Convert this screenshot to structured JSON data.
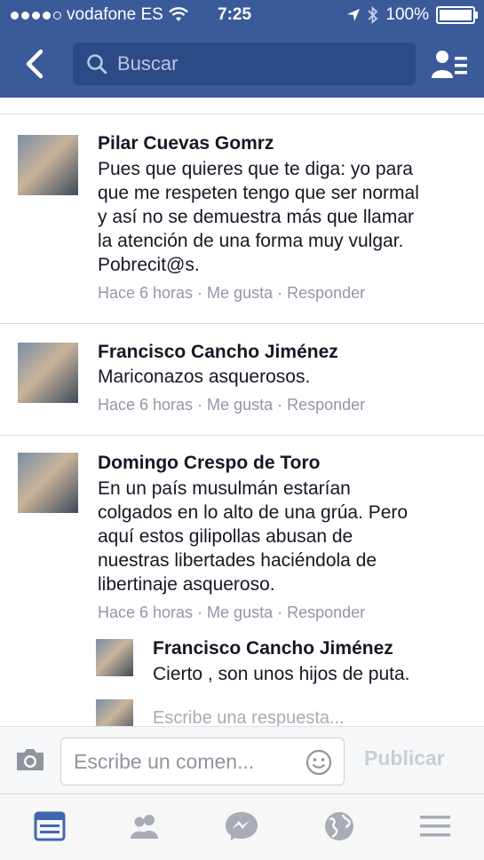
{
  "status_bar": {
    "carrier": "vodafone ES",
    "time": "7:25",
    "battery": "100%"
  },
  "search": {
    "placeholder": "Buscar"
  },
  "comments": [
    {
      "name": "Pilar Cuevas Gomrz",
      "lines": [
        "Pues que quieres que te diga: yo para",
        "que me respeten tengo que ser normal",
        "y así no se demuestra  más que llamar",
        "la atención de una forma muy vulgar.",
        "Pobrecit@s."
      ],
      "meta": "Hace 6 horas · Me gusta · Responder"
    },
    {
      "name": "Francisco Cancho Jiménez",
      "lines": [
        "Mariconazos asquerosos."
      ],
      "meta": "Hace 6 horas · Me gusta · Responder"
    },
    {
      "name": "Domingo Crespo de Toro",
      "lines": [
        "En un país musulmán  estarían",
        "colgados en lo alto de una grúa. Pero",
        "aquí estos gilipollas abusan de",
        "nuestras libertades haciéndola de",
        "libertinaje asqueroso."
      ],
      "meta": "Hace 6 horas · Me gusta · Responder"
    }
  ],
  "reply": {
    "name": "Francisco Cancho Jiménez",
    "text": "Cierto , son unos hijos de puta.",
    "write_reply_placeholder": "Escribe una respuesta..."
  },
  "composer": {
    "placeholder": "Escribe un comen...",
    "publish_label": "Publicar"
  },
  "tabs": [
    "news-feed-icon",
    "friends-icon",
    "messenger-icon",
    "notifications-globe-icon",
    "menu-icon"
  ],
  "colors": {
    "header": "#3b5a9a",
    "active_tab": "#4267b2",
    "inactive_tab": "#a7acb5"
  }
}
